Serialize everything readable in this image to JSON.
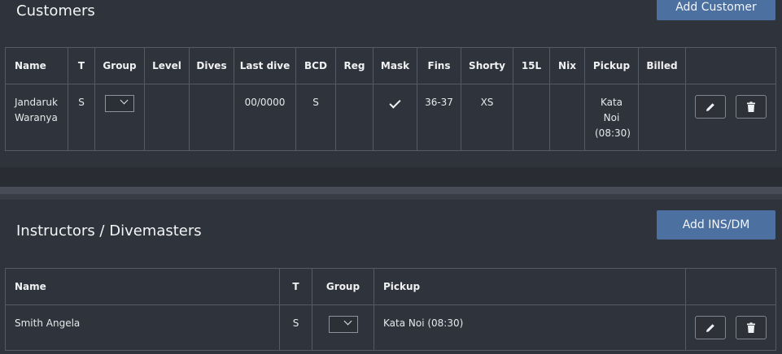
{
  "customers": {
    "title": "Customers",
    "add_button": "Add Customer",
    "columns": [
      "Name",
      "T",
      "Group",
      "Level",
      "Dives",
      "Last dive",
      "BCD",
      "Reg",
      "Mask",
      "Fins",
      "Shorty",
      "15L",
      "Nix",
      "Pickup",
      "Billed",
      ""
    ],
    "rows": [
      {
        "name": "Jandaruk Waranya",
        "t": "S",
        "group": "",
        "level": "",
        "dives": "",
        "last_dive": "00/0000",
        "bcd": "S",
        "reg": "",
        "mask": "check-icon",
        "fins": "36-37",
        "shorty": "XS",
        "l15": "",
        "nix": "",
        "pickup": "Kata Noi (08:30)",
        "billed": ""
      }
    ]
  },
  "instructors": {
    "title": "Instructors / Divemasters",
    "add_button": "Add INS/DM",
    "columns": [
      "Name",
      "T",
      "Group",
      "Pickup",
      ""
    ],
    "rows": [
      {
        "name": "Smith Angela",
        "t": "S",
        "group": "",
        "pickup": "Kata Noi (08:30)"
      }
    ]
  },
  "icons": {
    "edit": "pencil-icon",
    "delete": "trash-icon",
    "dropdown": "chevron-down-icon"
  },
  "colors": {
    "background": "#2f333b",
    "primary_button": "#4c70a0",
    "border": "#555b66"
  }
}
